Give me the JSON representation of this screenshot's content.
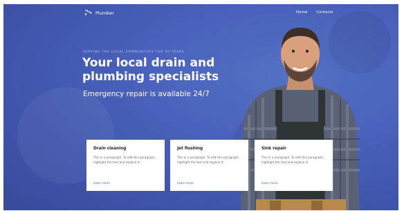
{
  "nav": {
    "logo_text": "Plumber",
    "links": [
      "Home",
      "Contacts"
    ]
  },
  "hero": {
    "eyebrow": "SERVING THE LOCAL COMMUNITIES FOR 30 YEARS",
    "title_line1": "Your local drain and",
    "title_line2": "plumbing specialists",
    "subtitle": "Emergency repair is available 24/7"
  },
  "cards": [
    {
      "title": "Drain cleaning",
      "body": "This is a paragraph. To edit this paragraph, highlight the text and replace it.",
      "link": "Learn more"
    },
    {
      "title": "Jet flushing",
      "body": "This is a paragraph. To edit this paragraph, highlight the text and replace it.",
      "link": "Learn more"
    },
    {
      "title": "Sink repair",
      "body": "This is a paragraph. To edit this paragraph, highlight the text and replace it.",
      "link": "Learn more"
    }
  ],
  "colors": {
    "hero_bg": "#4a62bb",
    "card_bg": "#ffffff",
    "link": "#4a63bb"
  },
  "icons": {
    "logo": "wrench-icon"
  }
}
